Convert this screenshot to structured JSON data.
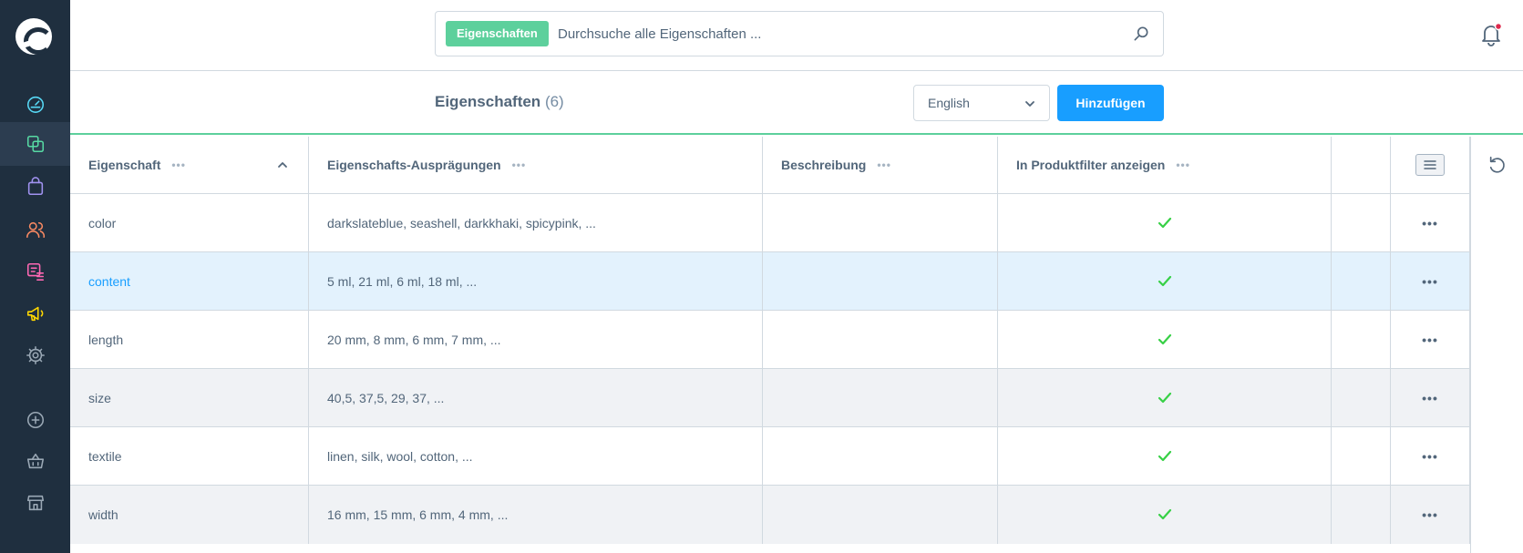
{
  "colors": {
    "sidebar_bg": "#1f2f3f",
    "accent_green": "#5dd09c",
    "primary_blue": "#189eff",
    "text": "#52667a",
    "row_highlight": "#e3f2fd",
    "row_stripe": "#f0f2f5"
  },
  "sidebar": {
    "logo": "shopware-logo",
    "items": [
      {
        "icon": "dashboard-icon",
        "color": "#57d9f6"
      },
      {
        "icon": "catalog-icon",
        "color": "#57d9a3",
        "active": true
      },
      {
        "icon": "orders-icon",
        "color": "#a092f0"
      },
      {
        "icon": "customers-icon",
        "color": "#f88962"
      },
      {
        "icon": "content-icon",
        "color": "#ff68b4"
      },
      {
        "icon": "marketing-icon",
        "color": "#ffd700"
      },
      {
        "icon": "settings-icon",
        "color": "#9aa8b5"
      },
      {
        "icon": "plus-circle-icon",
        "color": "#9aa8b5"
      },
      {
        "icon": "basket-icon",
        "color": "#9aa8b5"
      },
      {
        "icon": "store-icon",
        "color": "#9aa8b5"
      }
    ]
  },
  "search": {
    "chip_label": "Eigenschaften",
    "placeholder": "Durchsuche alle Eigenschaften ..."
  },
  "header": {
    "title": "Eigenschaften",
    "count": "(6)",
    "language": "English",
    "add_label": "Hinzufügen"
  },
  "grid": {
    "columns": [
      "Eigenschaft",
      "Eigenschafts-Ausprägungen",
      "Beschreibung",
      "In Produktfilter anzeigen"
    ],
    "rows": [
      {
        "name": "color",
        "values": "darkslateblue, seashell, darkkhaki, spicypink, ...",
        "description": "",
        "filter": true
      },
      {
        "name": "content",
        "values": "5 ml, 21 ml, 6 ml, 18 ml, ...",
        "description": "",
        "filter": true
      },
      {
        "name": "length",
        "values": "20 mm, 8 mm, 6 mm, 7 mm, ...",
        "description": "",
        "filter": true
      },
      {
        "name": "size",
        "values": "40,5, 37,5, 29, 37, ...",
        "description": "",
        "filter": true
      },
      {
        "name": "textile",
        "values": "linen, silk, wool, cotton, ...",
        "description": "",
        "filter": true
      },
      {
        "name": "width",
        "values": "16 mm, 15 mm, 6 mm, 4 mm, ...",
        "description": "",
        "filter": true
      }
    ]
  }
}
